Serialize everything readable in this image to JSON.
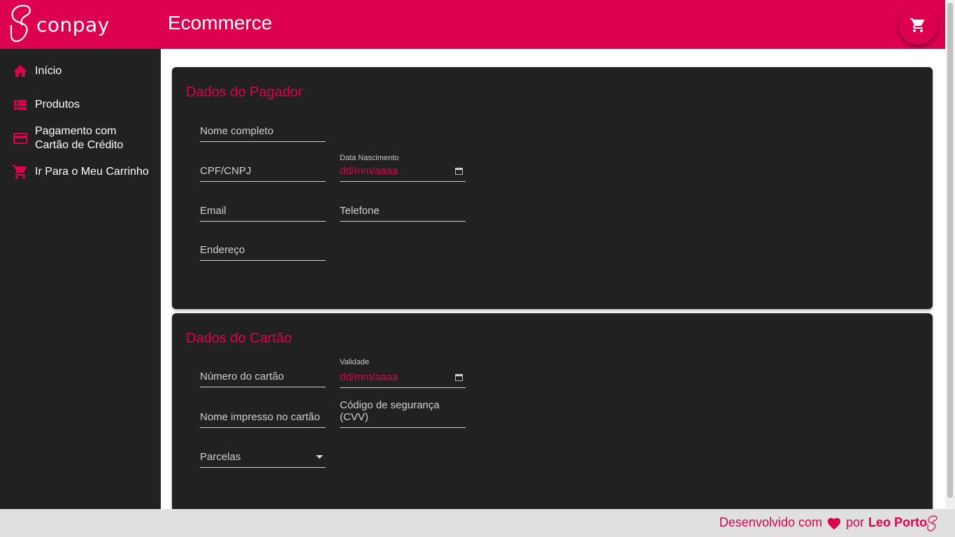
{
  "header": {
    "brand": "conpay",
    "title": "Ecommerce",
    "cart_icon": "shopping-cart-icon"
  },
  "colors": {
    "accent": "#dc004e",
    "sidebar_bg": "#212121",
    "footer_bg": "#e0e0e0"
  },
  "sidebar": {
    "items": [
      {
        "label": "Início",
        "icon": "home-icon"
      },
      {
        "label": "Produtos",
        "icon": "list-icon"
      },
      {
        "label_line1": "Pagamento com",
        "label_line2": "Cartão de Crédito",
        "icon": "credit-card-icon"
      },
      {
        "label": "Ir Para o Meu Carrinho",
        "icon": "shopping-cart-icon"
      }
    ]
  },
  "payer": {
    "title": "Dados do Pagador",
    "name": "Nome completo",
    "doc": "CPF/CNPJ",
    "birth_label": "Data Nascimento",
    "birth_placeholder": "dd/mm/aaaa",
    "email": "Email",
    "phone": "Telefone",
    "address": "Endereço"
  },
  "card": {
    "title": "Dados do Cartão",
    "number": "Número do cartão",
    "validity_label": "Validade",
    "validity_placeholder": "dd/mm/aaaa",
    "printed_name": "Nome impresso no cartão",
    "cvv": "Código de segurança (CVV)",
    "installments": "Parcelas"
  },
  "footer": {
    "prefix": "Desenvolvido com",
    "by": "por",
    "author": "Leo Porto"
  }
}
